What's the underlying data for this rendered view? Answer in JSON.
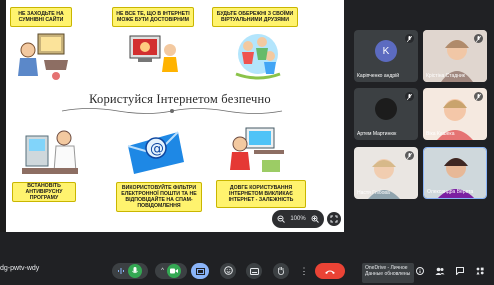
{
  "slide": {
    "headline": "Користуйся Інтернетом безпечно",
    "notes": [
      "НЕ ЗАХОДЬТЕ НА СУМНІВНІ САЙТИ",
      "НЕ ВСЕ ТЕ, ЩО В ІНТЕРНЕТІ МОЖЕ БУТИ ДОСТОВІРНИМ",
      "БУДЬТЕ ОБЕРЕЖНІ З СВОЇМИ ВІРТУАЛЬНИМИ ДРУЗЯМИ",
      "ВСТАНОВІТЬ АНТИВІРУСНУ ПРОГРАМУ",
      "ВИКОРИСТОВУЙТЕ ФІЛЬТРИ ЕЛЕКТРОННОЇ ПОШТИ ТА НЕ ВІДПОВІДАЙТЕ НА СПАМ-ПОВІДОМЛЕННЯ",
      "ДОВГЕ КОРИСТУВАННЯ ІНТЕРНЕТОМ ВИКЛИКАЄ ІНТЕРНЕТ - ЗАЛЕЖНІСТЬ"
    ]
  },
  "zoom": {
    "level": "100%",
    "minus_icon": "zoom-out-icon",
    "plus_icon": "zoom-in-icon",
    "expand_icon": "expand-icon"
  },
  "participants": [
    {
      "name": "Каріпченко андрій",
      "initial": "K",
      "avatar_color": "#5c6bc0",
      "muted": true
    },
    {
      "name": "Крістіна Стадник",
      "initial": "",
      "muted": true
    },
    {
      "name": "Артем Мартинюк",
      "initial": "",
      "muted": true
    },
    {
      "name": "Віка Кашека",
      "initial": "",
      "muted": true
    },
    {
      "name": "Настя Глібова",
      "initial": "",
      "muted": true
    },
    {
      "name": "Олександра Верета",
      "initial": "",
      "muted": false
    }
  ],
  "bottom_bar": {
    "meeting_code": "dg-pwtv-wdy",
    "toast_line1": "OneDrive - Личное",
    "toast_line2": "Данные обновлены",
    "accent_red": "#ea4335",
    "accent_green": "#34a853",
    "accent_blue": "#8ab4f8"
  }
}
